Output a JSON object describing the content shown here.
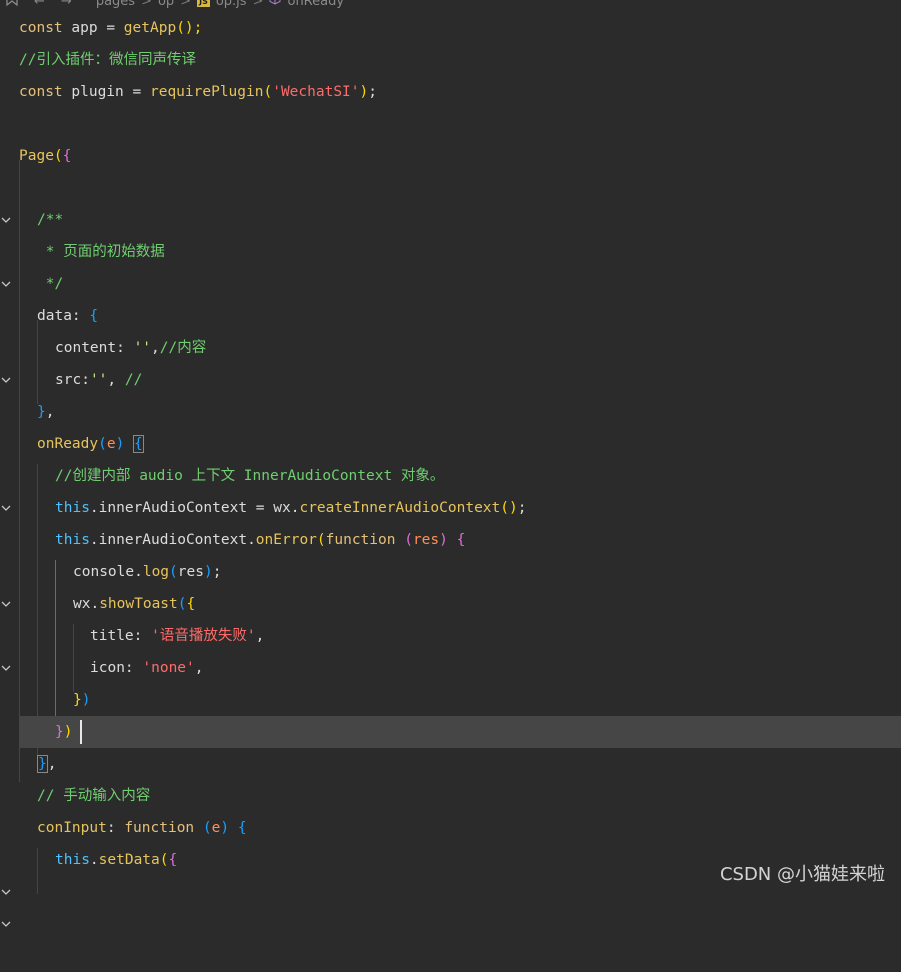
{
  "breadcrumb": {
    "items": [
      "pages",
      "op",
      "op.js",
      "onReady"
    ],
    "separator": ">"
  },
  "code": {
    "lines": [
      "const app = getApp();",
      "//引入插件：微信同声传译",
      "const plugin = requirePlugin('WechatSI');",
      "",
      "Page({",
      "",
      "/**",
      " * 页面的初始数据",
      " */",
      "data: {",
      "content: '',//内容",
      "src:'', //",
      "},",
      "onReady(e) {",
      "//创建内部 audio 上下文 InnerAudioContext 对象。",
      "this.innerAudioContext = wx.createInnerAudioContext();",
      "this.innerAudioContext.onError(function (res) {",
      "console.log(res);",
      "wx.showToast({",
      "title: '语音播放失败',",
      "icon: 'none',",
      "})",
      "})",
      "},",
      "// 手动输入内容",
      "conInput: function (e) {",
      "this.setData({"
    ]
  },
  "tokens": {
    "const": "const",
    "app": "app",
    "eq": "=",
    "getApp": "getApp",
    "callEnd": "();",
    "comment_plugin": "//引入插件：微信同声传译",
    "plugin": "plugin",
    "requirePlugin": "requirePlugin",
    "wechatsi": "'WechatSI'",
    "page": "Page",
    "docStart": "/**",
    "docBody": " * 页面的初始数据",
    "docEnd": " */",
    "data": "data",
    "content": "content",
    "emptyStr": "''",
    "comment_content": "//内容",
    "src": "src",
    "comment_src": "//",
    "onReady": "onReady",
    "e": "e",
    "comment_audio": "//创建内部 audio 上下文 InnerAudioContext 对象。",
    "this": "this",
    "innerAudioContext": ".innerAudioContext",
    "wx": "wx",
    "createInner": "createInnerAudioContext",
    "onError": "onError",
    "function": "function",
    "res": "res",
    "console": "console",
    "log": "log",
    "showToast": "showToast",
    "title": "title",
    "titleVal": "'语音播放失败'",
    "icon": "icon",
    "none": "'none'",
    "comment_manual": "// 手动输入内容",
    "conInput": "conInput",
    "setData": "setData"
  },
  "watermark": "CSDN @小猫娃来啦",
  "colors": {
    "background": "#2b2b2b",
    "current_line": "#464646",
    "keyword": "#e5c07b",
    "comment": "#6fcf6f",
    "string": "#c3e88d",
    "string_red": "#ff6b6b",
    "bracket_pink": "#da70d6",
    "bracket_yellow": "#ffd700",
    "bracket_blue": "#179fff",
    "this": "#4fc1ff",
    "param": "#ff8f5a"
  },
  "icons": [
    "bookmark-icon",
    "back-arrow-icon",
    "forward-arrow-icon",
    "js-file-icon",
    "method-cube-icon",
    "fold-chevron-icon"
  ]
}
